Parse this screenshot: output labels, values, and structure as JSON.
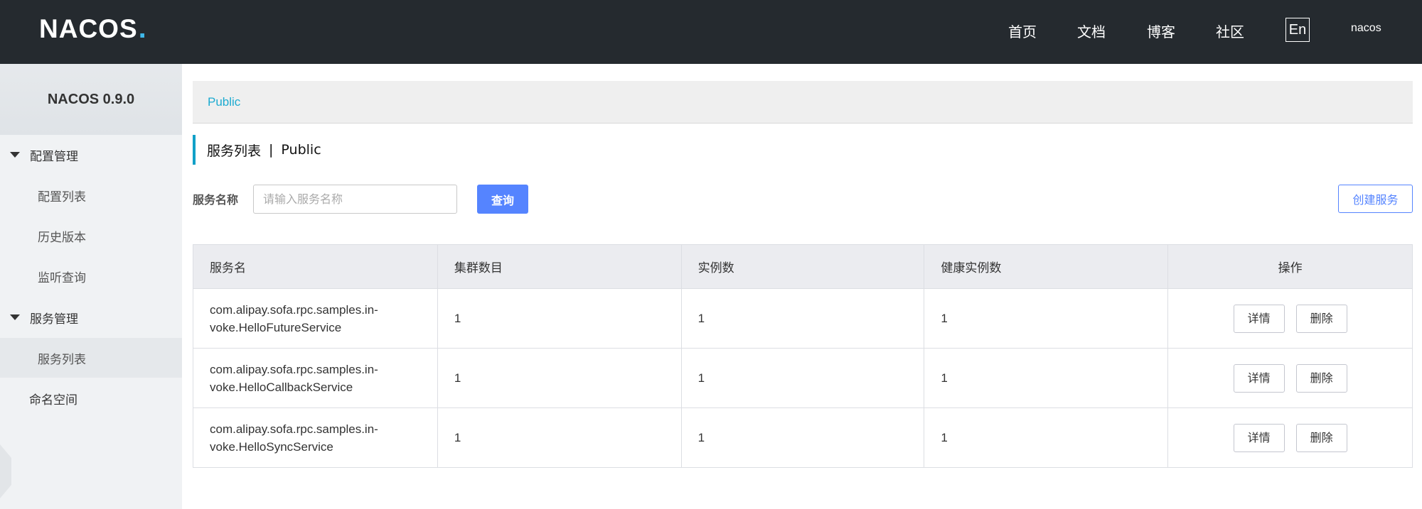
{
  "topbar": {
    "logo": {
      "text": "NACOS",
      "dot": "."
    },
    "nav": [
      "首页",
      "文档",
      "博客",
      "社区"
    ],
    "lang": "En",
    "user": "nacos"
  },
  "sidebar": {
    "title": "NACOS 0.9.0",
    "groups": [
      {
        "label": "配置管理",
        "items": [
          "配置列表",
          "历史版本",
          "监听查询"
        ]
      },
      {
        "label": "服务管理",
        "items": [
          "服务列表"
        ]
      }
    ],
    "active_item": "服务列表",
    "namespace": "命名空间"
  },
  "breadcrumb": {
    "namespace": "Public"
  },
  "page": {
    "title": "服务列表",
    "separator": "|",
    "namespace": "Public"
  },
  "search": {
    "label": "服务名称",
    "placeholder": "请输入服务名称",
    "value": "",
    "query_label": "查询",
    "create_label": "创建服务"
  },
  "table": {
    "headers": [
      "服务名",
      "集群数目",
      "实例数",
      "健康实例数",
      "操作"
    ],
    "rows": [
      {
        "name_line1": "com.alipay.sofa.rpc.samples.in-",
        "name_line2": "voke.HelloFutureService",
        "clusters": "1",
        "instances": "1",
        "healthy": "1",
        "detail": "详情",
        "delete": "删除"
      },
      {
        "name_line1": "com.alipay.sofa.rpc.samples.in-",
        "name_line2": "voke.HelloCallbackService",
        "clusters": "1",
        "instances": "1",
        "healthy": "1",
        "detail": "详情",
        "delete": "删除"
      },
      {
        "name_line1": "com.alipay.sofa.rpc.samples.in-",
        "name_line2": "voke.HelloSyncService",
        "clusters": "1",
        "instances": "1",
        "healthy": "1",
        "detail": "详情",
        "delete": "删除"
      }
    ]
  },
  "colors": {
    "topbar": "#252a2f",
    "accent": "#5584ff",
    "breadcrumb": "#1dabd1",
    "title_bar": "#10a0c8"
  }
}
